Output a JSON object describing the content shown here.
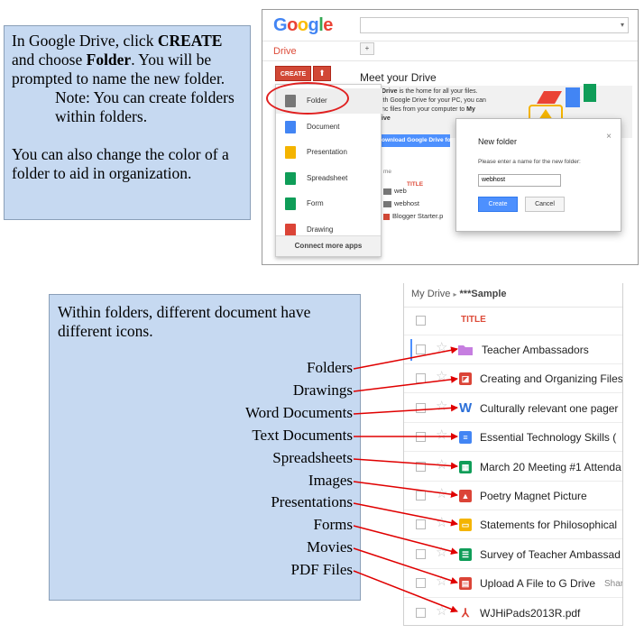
{
  "top_instructions": {
    "line1_pre": "In Google Drive, click ",
    "line1_bold": "CREATE",
    "line2_pre": "and choose ",
    "line2_bold": "Folder",
    "line2_post": ".  You will be prompted to name the new folder.",
    "note": "Note: You can create folders within folders.",
    "color_tip": "You can also change the color of a folder to aid in organization."
  },
  "drive": {
    "logo": [
      "G",
      "o",
      "o",
      "g",
      "l",
      "e"
    ],
    "logo_colors": [
      "#4285f4",
      "#ea4335",
      "#fbbc05",
      "#4285f4",
      "#34a853",
      "#ea4335"
    ],
    "section_title": "Drive",
    "create_label": "CREATE",
    "meet_title": "Meet your Drive",
    "welcome_pre": "Drive",
    "welcome_line1": " is the home for all your files.",
    "welcome_line2": "ith Google Drive for your PC, you can",
    "welcome_line3": "nc files from your computer to ",
    "welcome_bold3": "My",
    "welcome_line4": "ive",
    "download_label": "ownload Google Drive for",
    "menu_items": [
      {
        "label": "Folder",
        "icon": "folder-icon",
        "color": "#777777"
      },
      {
        "label": "Document",
        "icon": "document-icon",
        "color": "#4285f4"
      },
      {
        "label": "Presentation",
        "icon": "presentation-icon",
        "color": "#f4b400"
      },
      {
        "label": "Spreadsheet",
        "icon": "spreadsheet-icon",
        "color": "#0f9d58"
      },
      {
        "label": "Form",
        "icon": "form-icon",
        "color": "#0f9d58"
      },
      {
        "label": "Drawing",
        "icon": "drawing-icon",
        "color": "#db4437"
      }
    ],
    "connect_label": "Connect more apps",
    "list_header_partial": "me",
    "list_title_header": "TITLE",
    "files": [
      "web",
      "webhost",
      "Blogger Starter.p"
    ],
    "dialog": {
      "title": "New folder",
      "close": "×",
      "prompt": "Please enter a name for the new folder:",
      "value": "webhost",
      "create": "Create",
      "cancel": "Cancel"
    }
  },
  "bottom_intro": "Within folders, different document have different icons.",
  "labels": [
    "Folders",
    "Drawings",
    "Word Documents",
    "Text Documents",
    "Spreadsheets",
    "Images",
    "Presentations",
    "Forms",
    "Movies",
    "PDF Files"
  ],
  "file_list": {
    "breadcrumb_root": "My Drive",
    "breadcrumb_sep": "▸",
    "breadcrumb_current": "***Sample",
    "title_header": "TITLE",
    "rows": [
      {
        "title": "Teacher Ambassadors",
        "icon": "folder-icon",
        "color": "#c67ee0",
        "glyph": ""
      },
      {
        "title": "Creating and Organizing Files",
        "icon": "drawing-icon",
        "color": "#db4437",
        "glyph": "◪"
      },
      {
        "title": "Culturally relevant one pager",
        "icon": "word-icon",
        "color": "#2b6fd8",
        "glyph": "W"
      },
      {
        "title": "Essential Technology Skills (",
        "icon": "document-icon",
        "color": "#4285f4",
        "glyph": "≡"
      },
      {
        "title": "March 20 Meeting #1 Attenda",
        "icon": "spreadsheet-icon",
        "color": "#0f9d58",
        "glyph": "▦"
      },
      {
        "title": "Poetry Magnet Picture",
        "icon": "image-icon",
        "color": "#db4437",
        "glyph": "▲"
      },
      {
        "title": "Statements for Philosophical",
        "icon": "presentation-icon",
        "color": "#f4b400",
        "glyph": "▭"
      },
      {
        "title": "Survey of Teacher Ambassad",
        "icon": "form-icon",
        "color": "#0f9d58",
        "glyph": "☰"
      },
      {
        "title": "Upload A File to G Drive",
        "icon": "movie-icon",
        "color": "#db4437",
        "glyph": "▤",
        "extra": "Shar"
      },
      {
        "title": "WJHiPads2013R.pdf",
        "icon": "pdf-icon",
        "color": "#db4437",
        "glyph": "⅄"
      }
    ]
  },
  "colors": {
    "callout_bg": "#c6d9f1",
    "arrow": "#e00000",
    "drive_red": "#d14836",
    "drive_blue": "#4d90fe"
  }
}
